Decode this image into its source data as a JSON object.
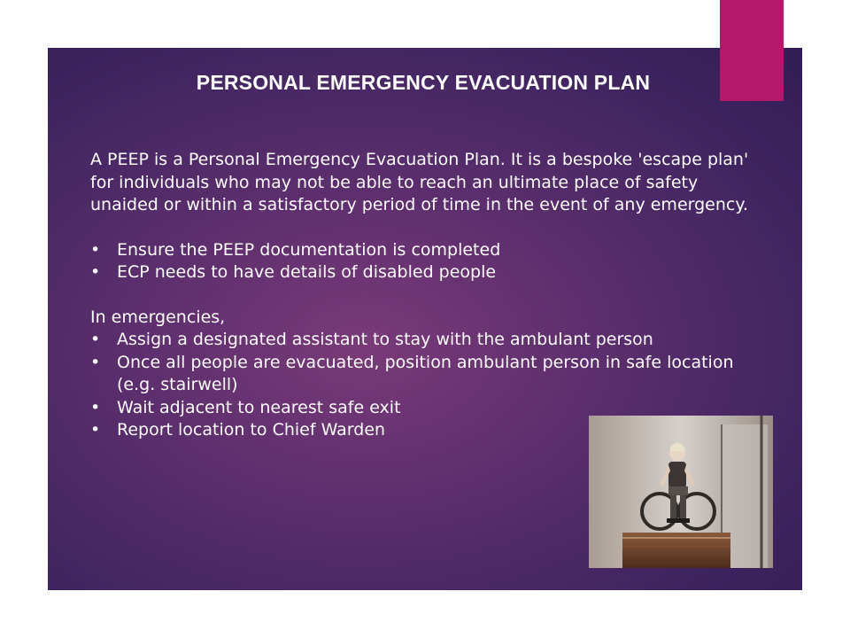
{
  "slide": {
    "title": "PERSONAL EMERGENCY EVACUATION PLAN",
    "intro": "A PEEP is a Personal Emergency Evacuation Plan. It is a bespoke 'escape plan' for individuals who may not be able to reach an ultimate place of safety unaided or within a satisfactory period of time in the event of any emergency.",
    "bullet_char": "•",
    "bullets_1": [
      "Ensure the PEEP documentation is completed",
      "ECP needs to have details of disabled people"
    ],
    "emergencies_heading": "In emergencies,",
    "bullets_2": [
      "Assign a designated assistant to stay with the ambulant person",
      "Once all people are evacuated, position ambulant person in safe location (e.g. stairwell)",
      "Wait adjacent to nearest safe exit",
      "Report location to Chief Warden"
    ]
  },
  "colors": {
    "accent": "#b5176a",
    "background": "#5e2f6e",
    "text": "#ffffff"
  },
  "image": {
    "subject": "person-in-wheelchair-at-stairs-photo"
  }
}
